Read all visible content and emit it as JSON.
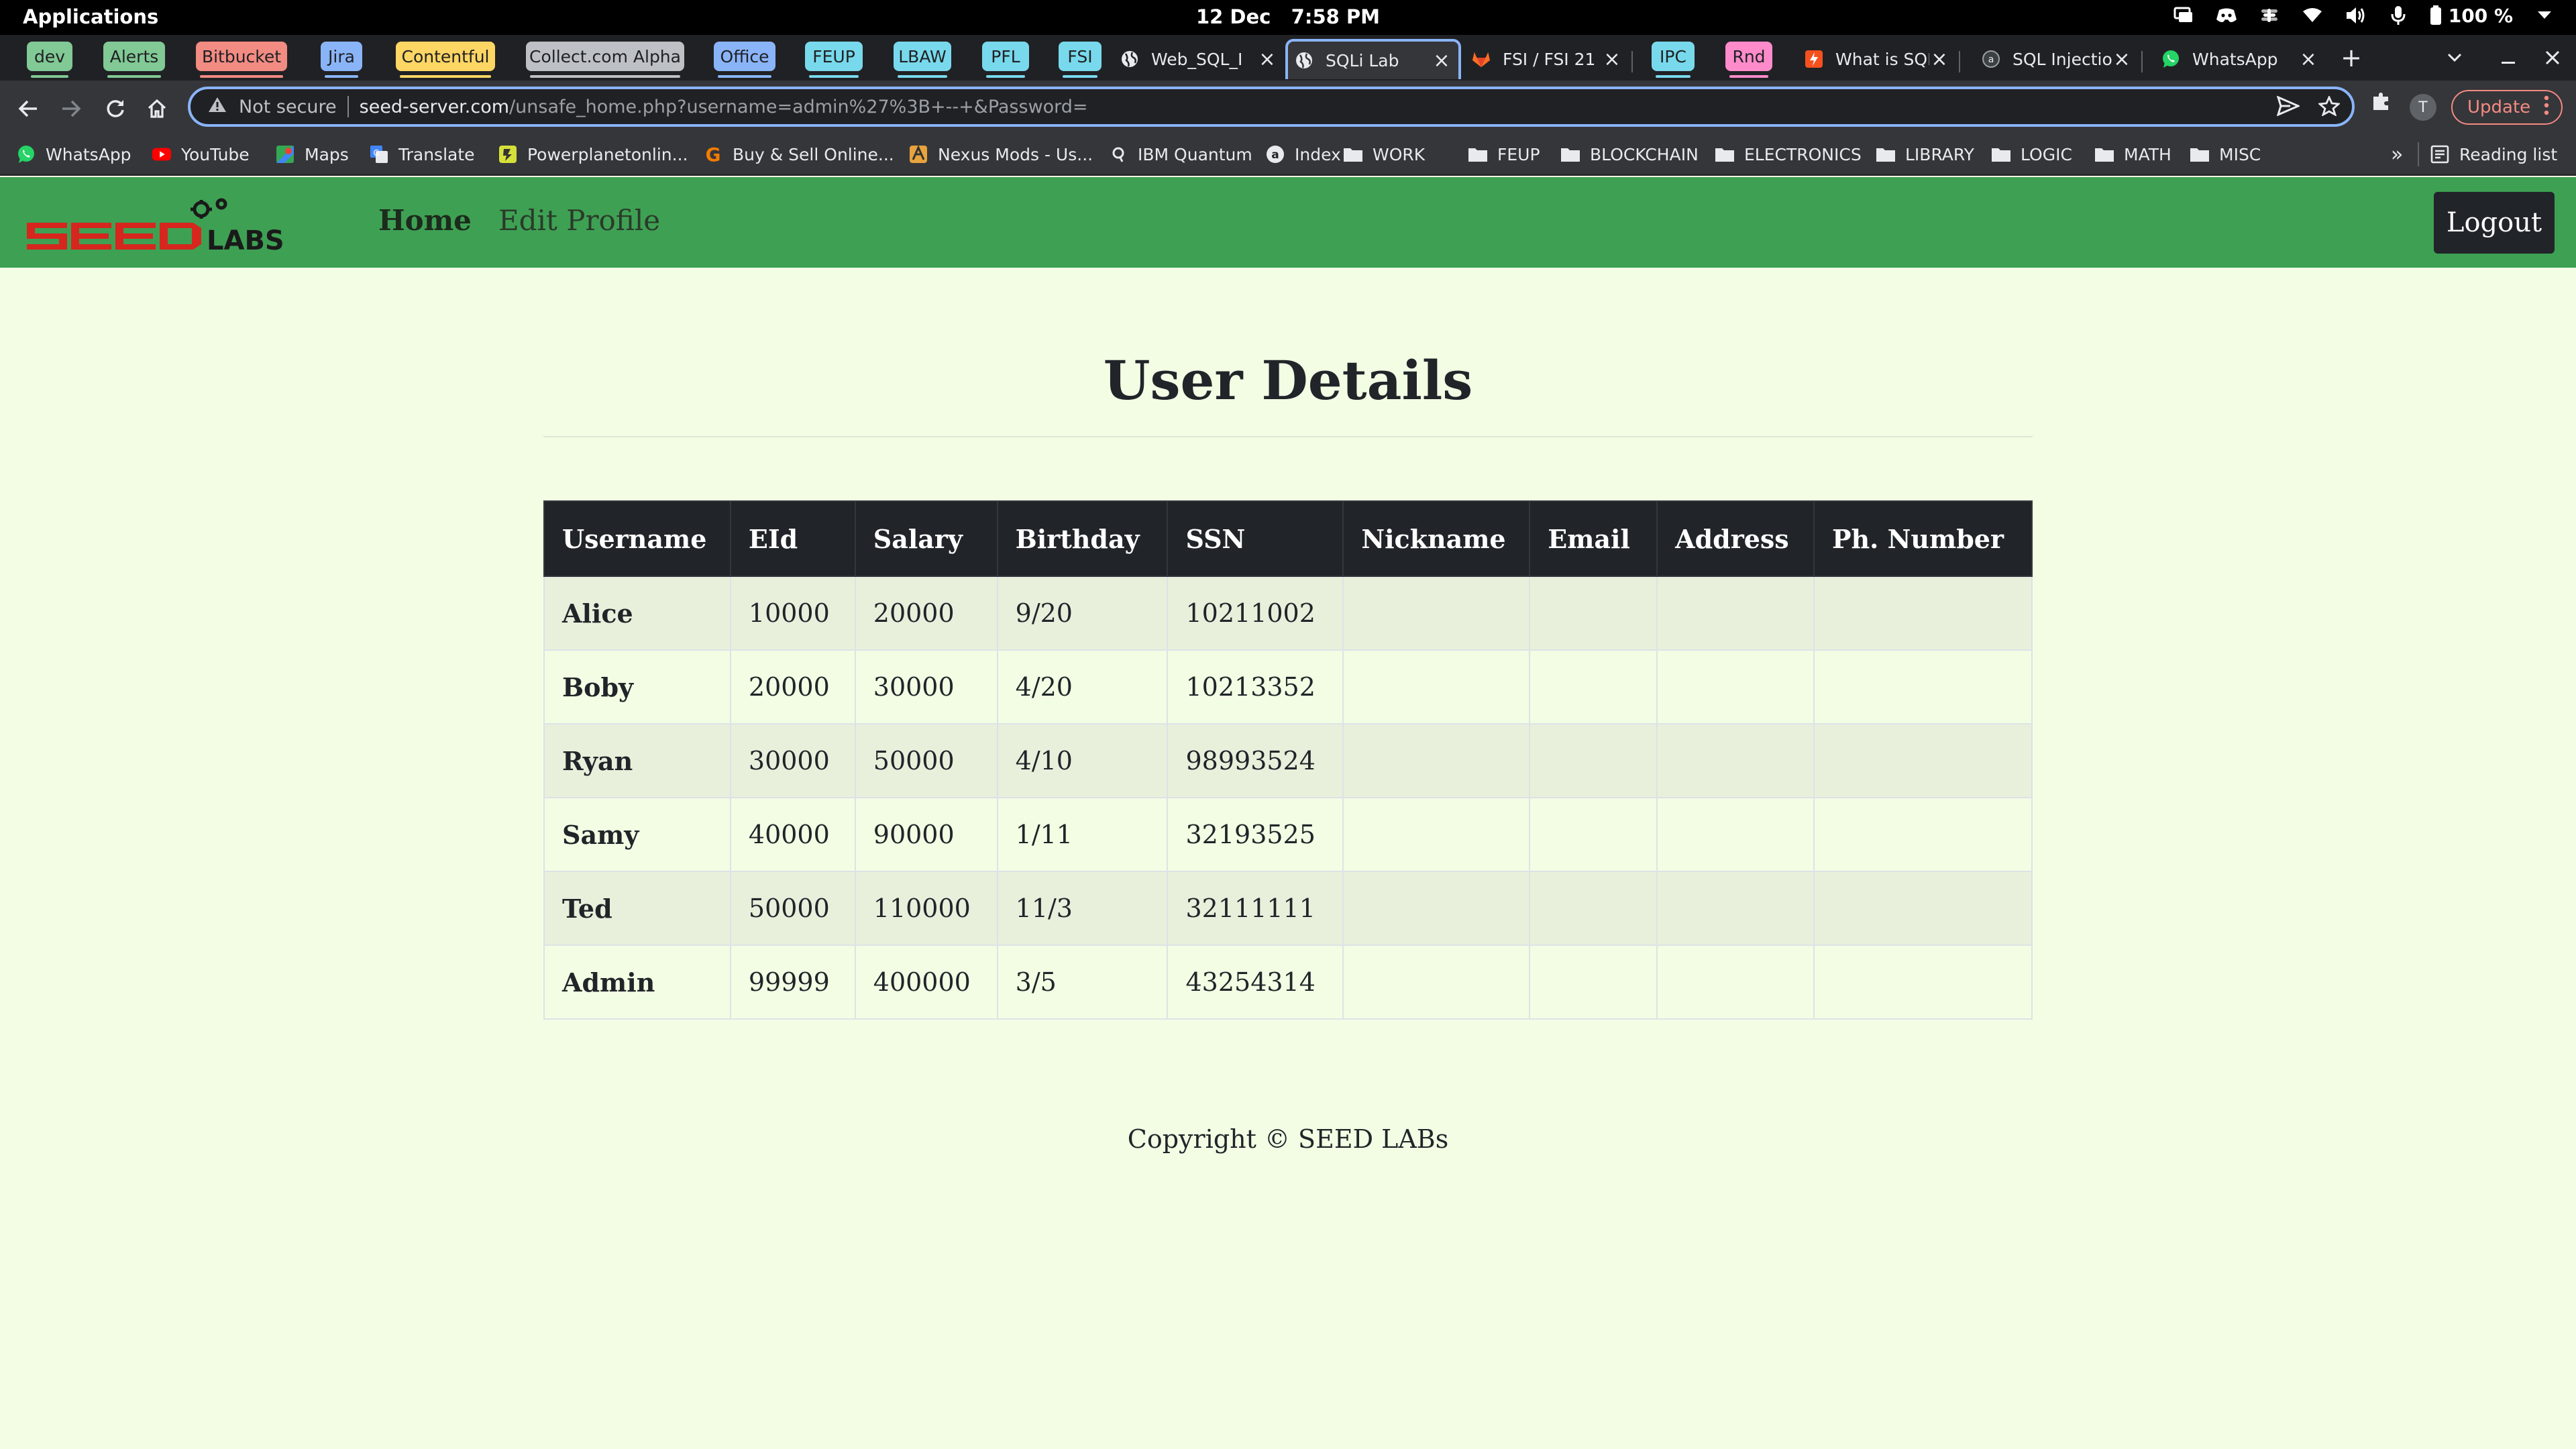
{
  "system_bar": {
    "apps_label": "Applications",
    "date": "12 Dec",
    "time": "7:58 PM",
    "battery": "100 %"
  },
  "tab_groups": [
    {
      "label": "dev",
      "color": "#81c995"
    },
    {
      "label": "Alerts",
      "color": "#81c995"
    },
    {
      "label": "Bitbucket",
      "color": "#f28b82"
    },
    {
      "label": "Jira",
      "color": "#8ab4f8"
    },
    {
      "label": "Contentful",
      "color": "#fdd663"
    },
    {
      "label": "Collect.com Alpha",
      "color": "#bdc1c6"
    },
    {
      "label": "Office",
      "color": "#8ab4f8"
    },
    {
      "label": "FEUP",
      "color": "#78d9ec"
    },
    {
      "label": "LBAW",
      "color": "#78d9ec"
    },
    {
      "label": "PFL",
      "color": "#78d9ec"
    },
    {
      "label": "FSI",
      "color": "#78d9ec"
    },
    {
      "label": "IPC",
      "color": "#78d9ec"
    },
    {
      "label": "Rnd",
      "color": "#ff8bcb"
    }
  ],
  "tabs": [
    {
      "title": "Web_SQL_I",
      "icon": "globe-icon"
    },
    {
      "title": "SQLi Lab",
      "icon": "globe-icon",
      "active": true
    },
    {
      "title": "FSI / FSI 21",
      "icon": "gitlab-icon"
    },
    {
      "title": "What is SQL",
      "icon": "bookmark-icon"
    },
    {
      "title": "SQL Injectio",
      "icon": "site-icon"
    },
    {
      "title": "WhatsApp",
      "icon": "whatsapp-icon"
    }
  ],
  "omnibox": {
    "security_label": "Not secure",
    "host": "seed-server.com",
    "path": "/unsafe_home.php?username=admin%27%3B+--+&Password="
  },
  "toolbar": {
    "profile_initial": "T",
    "update_label": "Update"
  },
  "bookmarks": [
    {
      "label": "WhatsApp",
      "icon": "whatsapp-icon"
    },
    {
      "label": "YouTube",
      "icon": "youtube-icon"
    },
    {
      "label": "Maps",
      "icon": "maps-icon"
    },
    {
      "label": "Translate",
      "icon": "translate-icon"
    },
    {
      "label": "Powerplanetonlin...",
      "icon": "site-icon"
    },
    {
      "label": "Buy & Sell Online...",
      "icon": "site-icon"
    },
    {
      "label": "Nexus Mods - Us...",
      "icon": "site-icon"
    },
    {
      "label": "IBM Quantum",
      "icon": "quantum-icon"
    },
    {
      "label": "Index",
      "icon": "site-icon"
    },
    {
      "label": "WORK",
      "icon": "folder-icon"
    },
    {
      "label": "FEUP",
      "icon": "folder-icon"
    },
    {
      "label": "BLOCKCHAIN",
      "icon": "folder-icon"
    },
    {
      "label": "ELECTRONICS",
      "icon": "folder-icon"
    },
    {
      "label": "LIBRARY",
      "icon": "folder-icon"
    },
    {
      "label": "LOGIC",
      "icon": "folder-icon"
    },
    {
      "label": "MATH",
      "icon": "folder-icon"
    },
    {
      "label": "MISC",
      "icon": "folder-icon"
    }
  ],
  "bookmarks_overflow": "»",
  "reading_list": "Reading list",
  "site": {
    "logo_text": "SEED LABS",
    "nav": {
      "home": "Home",
      "edit_profile": "Edit Profile"
    },
    "logout": "Logout",
    "title": "User Details",
    "copyright": "Copyright © SEED LABs"
  },
  "table": {
    "headers": [
      "Username",
      "EId",
      "Salary",
      "Birthday",
      "SSN",
      "Nickname",
      "Email",
      "Address",
      "Ph. Number"
    ],
    "rows": [
      [
        "Alice",
        "10000",
        "20000",
        "9/20",
        "10211002",
        "",
        "",
        "",
        ""
      ],
      [
        "Boby",
        "20000",
        "30000",
        "4/20",
        "10213352",
        "",
        "",
        "",
        ""
      ],
      [
        "Ryan",
        "30000",
        "50000",
        "4/10",
        "98993524",
        "",
        "",
        "",
        ""
      ],
      [
        "Samy",
        "40000",
        "90000",
        "1/11",
        "32193525",
        "",
        "",
        "",
        ""
      ],
      [
        "Ted",
        "50000",
        "110000",
        "11/3",
        "32111111",
        "",
        "",
        "",
        ""
      ],
      [
        "Admin",
        "99999",
        "400000",
        "3/5",
        "43254314",
        "",
        "",
        "",
        ""
      ]
    ]
  },
  "colors": {
    "nav_green": "#3ea053",
    "page_bg": "#f2fde4",
    "table_header": "#212529",
    "active_tab_outline": "#8ab4f8"
  }
}
